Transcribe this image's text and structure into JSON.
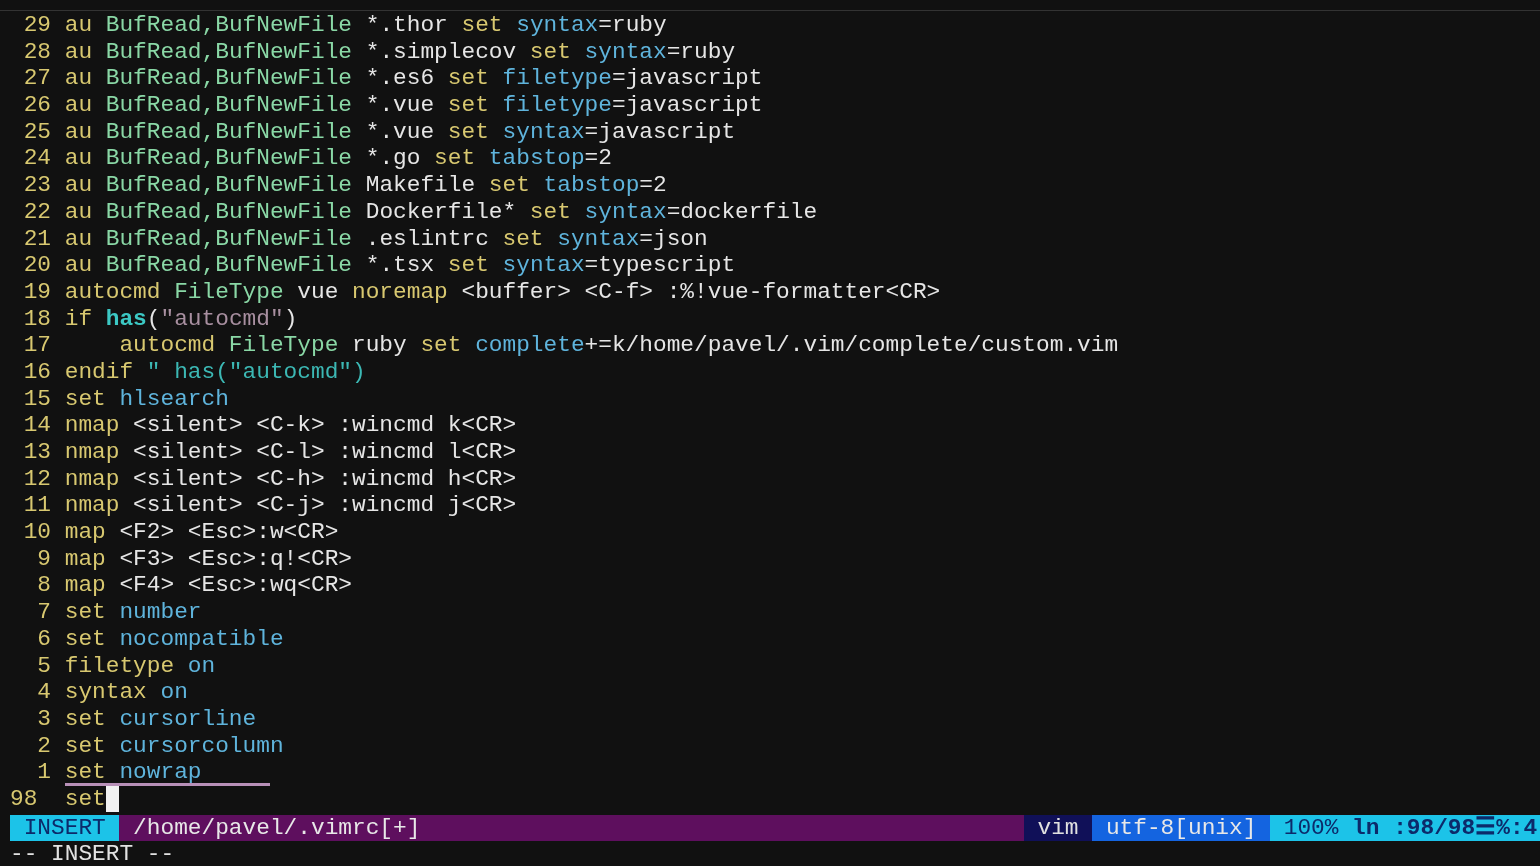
{
  "editor": {
    "lines": [
      {
        "number": "29",
        "segments": [
          {
            "text": "au",
            "kind": "keyword"
          },
          {
            "text": " BufRead,BufNewFile",
            "kind": "event"
          },
          {
            "text": " *.thor",
            "kind": "plain"
          },
          {
            "text": " set",
            "kind": "keyword"
          },
          {
            "text": " syntax",
            "kind": "option"
          },
          {
            "text": "=ruby",
            "kind": "plain"
          }
        ]
      },
      {
        "number": "28",
        "segments": [
          {
            "text": "au",
            "kind": "keyword"
          },
          {
            "text": " BufRead,BufNewFile",
            "kind": "event"
          },
          {
            "text": " *.simplecov",
            "kind": "plain"
          },
          {
            "text": " set",
            "kind": "keyword"
          },
          {
            "text": " syntax",
            "kind": "option"
          },
          {
            "text": "=ruby",
            "kind": "plain"
          }
        ]
      },
      {
        "number": "27",
        "segments": [
          {
            "text": "au",
            "kind": "keyword"
          },
          {
            "text": " BufRead,BufNewFile",
            "kind": "event"
          },
          {
            "text": " *.es6",
            "kind": "plain"
          },
          {
            "text": " set",
            "kind": "keyword"
          },
          {
            "text": " filetype",
            "kind": "option"
          },
          {
            "text": "=javascript",
            "kind": "plain"
          }
        ]
      },
      {
        "number": "26",
        "segments": [
          {
            "text": "au",
            "kind": "keyword"
          },
          {
            "text": " BufRead,BufNewFile",
            "kind": "event"
          },
          {
            "text": " *.vue",
            "kind": "plain"
          },
          {
            "text": " set",
            "kind": "keyword"
          },
          {
            "text": " filetype",
            "kind": "option"
          },
          {
            "text": "=javascript",
            "kind": "plain"
          }
        ]
      },
      {
        "number": "25",
        "segments": [
          {
            "text": "au",
            "kind": "keyword"
          },
          {
            "text": " BufRead,BufNewFile",
            "kind": "event"
          },
          {
            "text": " *.vue",
            "kind": "plain"
          },
          {
            "text": " set",
            "kind": "keyword"
          },
          {
            "text": " syntax",
            "kind": "option"
          },
          {
            "text": "=javascript",
            "kind": "plain"
          }
        ]
      },
      {
        "number": "24",
        "segments": [
          {
            "text": "au",
            "kind": "keyword"
          },
          {
            "text": " BufRead,BufNewFile",
            "kind": "event"
          },
          {
            "text": " *.go",
            "kind": "plain"
          },
          {
            "text": " set",
            "kind": "keyword"
          },
          {
            "text": " tabstop",
            "kind": "option"
          },
          {
            "text": "=2",
            "kind": "plain"
          }
        ]
      },
      {
        "number": "23",
        "segments": [
          {
            "text": "au",
            "kind": "keyword"
          },
          {
            "text": " BufRead,BufNewFile",
            "kind": "event"
          },
          {
            "text": " Makefile",
            "kind": "plain"
          },
          {
            "text": " set",
            "kind": "keyword"
          },
          {
            "text": " tabstop",
            "kind": "option"
          },
          {
            "text": "=2",
            "kind": "plain"
          }
        ]
      },
      {
        "number": "22",
        "segments": [
          {
            "text": "au",
            "kind": "keyword"
          },
          {
            "text": " BufRead,BufNewFile",
            "kind": "event"
          },
          {
            "text": " Dockerfile*",
            "kind": "plain"
          },
          {
            "text": " set",
            "kind": "keyword"
          },
          {
            "text": " syntax",
            "kind": "option"
          },
          {
            "text": "=dockerfile",
            "kind": "plain"
          }
        ]
      },
      {
        "number": "21",
        "segments": [
          {
            "text": "au",
            "kind": "keyword"
          },
          {
            "text": " BufRead,BufNewFile",
            "kind": "event"
          },
          {
            "text": " .eslintrc",
            "kind": "plain"
          },
          {
            "text": " set",
            "kind": "keyword"
          },
          {
            "text": " syntax",
            "kind": "option"
          },
          {
            "text": "=json",
            "kind": "plain"
          }
        ]
      },
      {
        "number": "20",
        "segments": [
          {
            "text": "au",
            "kind": "keyword"
          },
          {
            "text": " BufRead,BufNewFile",
            "kind": "event"
          },
          {
            "text": " *.tsx",
            "kind": "plain"
          },
          {
            "text": " set",
            "kind": "keyword"
          },
          {
            "text": " syntax",
            "kind": "option"
          },
          {
            "text": "=typescript",
            "kind": "plain"
          }
        ]
      },
      {
        "number": "19",
        "segments": [
          {
            "text": "autocmd",
            "kind": "keyword"
          },
          {
            "text": " FileType",
            "kind": "event"
          },
          {
            "text": " vue",
            "kind": "plain"
          },
          {
            "text": " noremap",
            "kind": "keyword"
          },
          {
            "text": " <buffer> <C-f> :%!vue-formatter<CR>",
            "kind": "plain"
          }
        ]
      },
      {
        "number": "18",
        "segments": [
          {
            "text": "if",
            "kind": "keyword"
          },
          {
            "text": " has",
            "kind": "function"
          },
          {
            "text": "(",
            "kind": "plain"
          },
          {
            "text": "\"autocmd\"",
            "kind": "string"
          },
          {
            "text": ")",
            "kind": "plain"
          }
        ]
      },
      {
        "number": "17",
        "segments": [
          {
            "text": "    autocmd",
            "kind": "keyword"
          },
          {
            "text": " FileType",
            "kind": "event"
          },
          {
            "text": " ruby",
            "kind": "plain"
          },
          {
            "text": " set",
            "kind": "keyword"
          },
          {
            "text": " complete",
            "kind": "option"
          },
          {
            "text": "+=k/home/pavel/.vim/complete/custom.vim",
            "kind": "plain"
          }
        ]
      },
      {
        "number": "16",
        "segments": [
          {
            "text": "endif",
            "kind": "keyword"
          },
          {
            "text": " \" has(\"autocmd\")",
            "kind": "comment"
          }
        ]
      },
      {
        "number": "15",
        "segments": [
          {
            "text": "set",
            "kind": "keyword"
          },
          {
            "text": " hlsearch",
            "kind": "option"
          }
        ]
      },
      {
        "number": "14",
        "segments": [
          {
            "text": "nmap",
            "kind": "keyword"
          },
          {
            "text": " <silent> <C-k> :wincmd k<CR>",
            "kind": "plain"
          }
        ]
      },
      {
        "number": "13",
        "segments": [
          {
            "text": "nmap",
            "kind": "keyword"
          },
          {
            "text": " <silent> <C-l> :wincmd l<CR>",
            "kind": "plain"
          }
        ]
      },
      {
        "number": "12",
        "segments": [
          {
            "text": "nmap",
            "kind": "keyword"
          },
          {
            "text": " <silent> <C-h> :wincmd h<CR>",
            "kind": "plain"
          }
        ]
      },
      {
        "number": "11",
        "segments": [
          {
            "text": "nmap",
            "kind": "keyword"
          },
          {
            "text": " <silent> <C-j> :wincmd j<CR>",
            "kind": "plain"
          }
        ]
      },
      {
        "number": "10",
        "segments": [
          {
            "text": "map",
            "kind": "keyword"
          },
          {
            "text": " <F2> <Esc>:w<CR>",
            "kind": "plain"
          }
        ]
      },
      {
        "number": "9",
        "segments": [
          {
            "text": "map",
            "kind": "keyword"
          },
          {
            "text": " <F3> <Esc>:q!<CR>",
            "kind": "plain"
          }
        ]
      },
      {
        "number": "8",
        "segments": [
          {
            "text": "map",
            "kind": "keyword"
          },
          {
            "text": " <F4> <Esc>:wq<CR>",
            "kind": "plain"
          }
        ]
      },
      {
        "number": "7",
        "segments": [
          {
            "text": "set",
            "kind": "keyword"
          },
          {
            "text": " number",
            "kind": "option"
          }
        ]
      },
      {
        "number": "6",
        "segments": [
          {
            "text": "set",
            "kind": "keyword"
          },
          {
            "text": " nocompatible",
            "kind": "option"
          }
        ]
      },
      {
        "number": "5",
        "segments": [
          {
            "text": "filetype",
            "kind": "keyword"
          },
          {
            "text": " on",
            "kind": "option"
          }
        ]
      },
      {
        "number": "4",
        "segments": [
          {
            "text": "syntax",
            "kind": "keyword"
          },
          {
            "text": " on",
            "kind": "option"
          }
        ]
      },
      {
        "number": "3",
        "segments": [
          {
            "text": "set",
            "kind": "keyword"
          },
          {
            "text": " cursorline",
            "kind": "option"
          }
        ]
      },
      {
        "number": "2",
        "segments": [
          {
            "text": "set",
            "kind": "keyword"
          },
          {
            "text": " cursorcolumn",
            "kind": "option"
          }
        ]
      },
      {
        "number": "1",
        "underlined": true,
        "segments": [
          {
            "text": "set",
            "kind": "keyword"
          },
          {
            "text": " nowrap",
            "kind": "option"
          }
        ]
      },
      {
        "number": "98",
        "current": true,
        "cursor": true,
        "segments": [
          {
            "text": "set",
            "kind": "keyword"
          }
        ]
      }
    ]
  },
  "status_bar": [
    {
      "kind": "mode",
      "text": "INSERT"
    },
    {
      "kind": "file",
      "text": "/home/pavel/.vimrc[+]"
    },
    {
      "kind": "filetype",
      "text": "vim"
    },
    {
      "kind": "encoding",
      "text": "utf-8[unix]"
    },
    {
      "kind": "percent",
      "text": "100%"
    },
    {
      "kind": "position",
      "text": "ln :98/98☰%:4"
    }
  ],
  "command_line": "-- INSERT --"
}
